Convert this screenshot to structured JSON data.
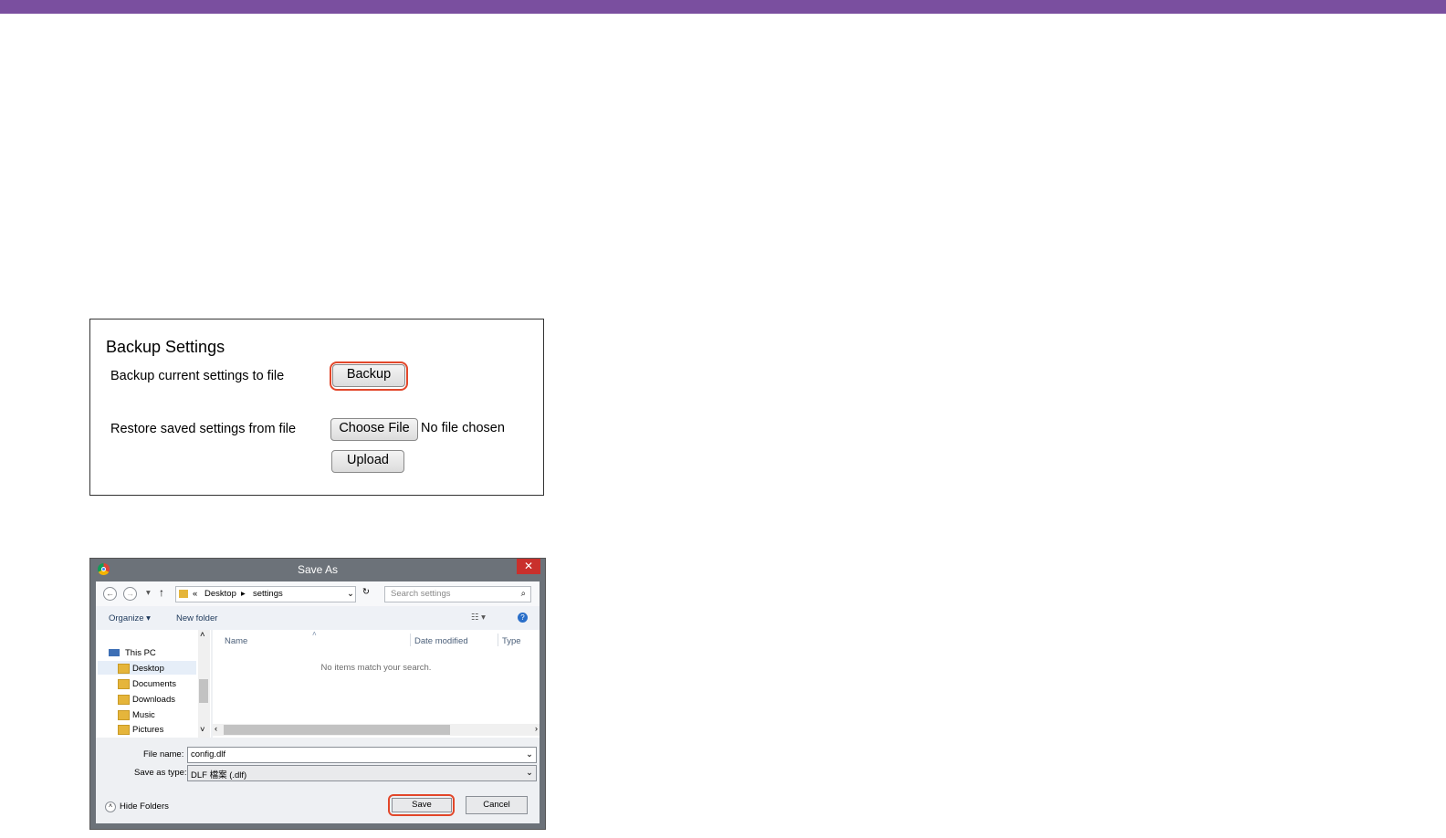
{
  "backup_panel": {
    "title": "Backup Settings",
    "backup_label": "Backup current settings to file",
    "backup_button": "Backup",
    "restore_label": "Restore saved settings from file",
    "choose_file_button": "Choose File",
    "no_file_text": "No file chosen",
    "upload_button": "Upload"
  },
  "save_dialog": {
    "title": "Save As",
    "close_glyph": "✕",
    "breadcrumb": {
      "prefix": "«",
      "desktop": "Desktop",
      "sep": "▸",
      "folder": "settings"
    },
    "search_placeholder": "Search settings",
    "toolbar": {
      "organize": "Organize ▾",
      "new_folder": "New folder"
    },
    "tree": [
      {
        "label": "This PC"
      },
      {
        "label": "Desktop"
      },
      {
        "label": "Documents"
      },
      {
        "label": "Downloads"
      },
      {
        "label": "Music"
      },
      {
        "label": "Pictures"
      }
    ],
    "columns": {
      "name": "Name",
      "date": "Date modified",
      "type": "Type"
    },
    "empty_text": "No items match your search.",
    "file_name_label": "File name:",
    "file_name_value": "config.dlf",
    "save_type_label": "Save as type:",
    "save_type_value": "DLF 檔案 (.dlf)",
    "hide_folders": "Hide Folders",
    "save_button": "Save",
    "cancel_button": "Cancel"
  },
  "colors": {
    "topbar": "#7a4f9f",
    "highlight": "#e2472a"
  }
}
